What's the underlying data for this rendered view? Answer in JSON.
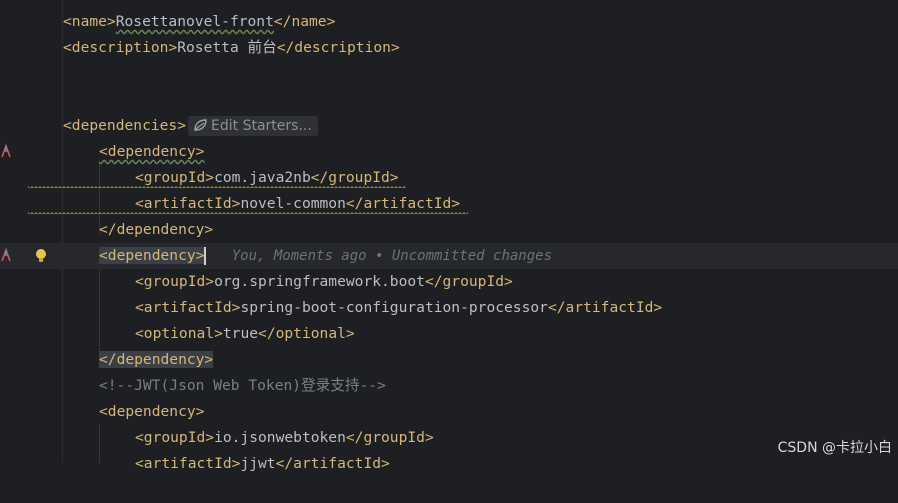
{
  "editor": {
    "lines": {
      "name_open": "<name>",
      "name_value": "Rosettanovel-front",
      "name_close": "</name>",
      "desc_open": "<description>",
      "desc_value": "Rosetta 前台",
      "desc_close": "</description>",
      "deps_open": "<dependencies>",
      "edit_starters": "Edit Starters...",
      "dep1_open": "<dependency>",
      "dep1_group_open": "<groupId>",
      "dep1_group_value": "com.java2nb",
      "dep1_group_close": "</groupId>",
      "dep1_artifact_open": "<artifactId>",
      "dep1_artifact_value": "novel-common",
      "dep1_artifact_close": "</artifactId>",
      "dep1_close": "</dependency>",
      "dep2_open": "<dependency>",
      "blame": "You, Moments ago • Uncommitted changes",
      "dep2_group_open": "<groupId>",
      "dep2_group_value": "org.springframework.boot",
      "dep2_group_close": "</groupId>",
      "dep2_artifact_open": "<artifactId>",
      "dep2_artifact_value": "spring-boot-configuration-processor",
      "dep2_artifact_close": "</artifactId>",
      "dep2_optional_open": "<optional>",
      "dep2_optional_value": "true",
      "dep2_optional_close": "</optional>",
      "dep2_close": "</dependency>",
      "comment": "<!--JWT(Json Web Token)登录支持-->",
      "dep3_open": "<dependency>",
      "dep3_group_open": "<groupId>",
      "dep3_group_value": "io.jsonwebtoken",
      "dep3_group_close": "</groupId>",
      "dep3_artifact_open": "<artifactId>",
      "dep3_artifact_value": "jjwt",
      "dep3_artifact_close": "</artifactId>"
    }
  },
  "watermark": "CSDN @卡拉小白",
  "colors": {
    "background": "#1e1f22",
    "tag": "#d5b778",
    "text": "#bcbec4",
    "comment": "#7a7e85",
    "current_line": "#26282e"
  },
  "icons": [
    "run-gutter-icon",
    "lightbulb-icon",
    "spring-leaf-icon"
  ]
}
